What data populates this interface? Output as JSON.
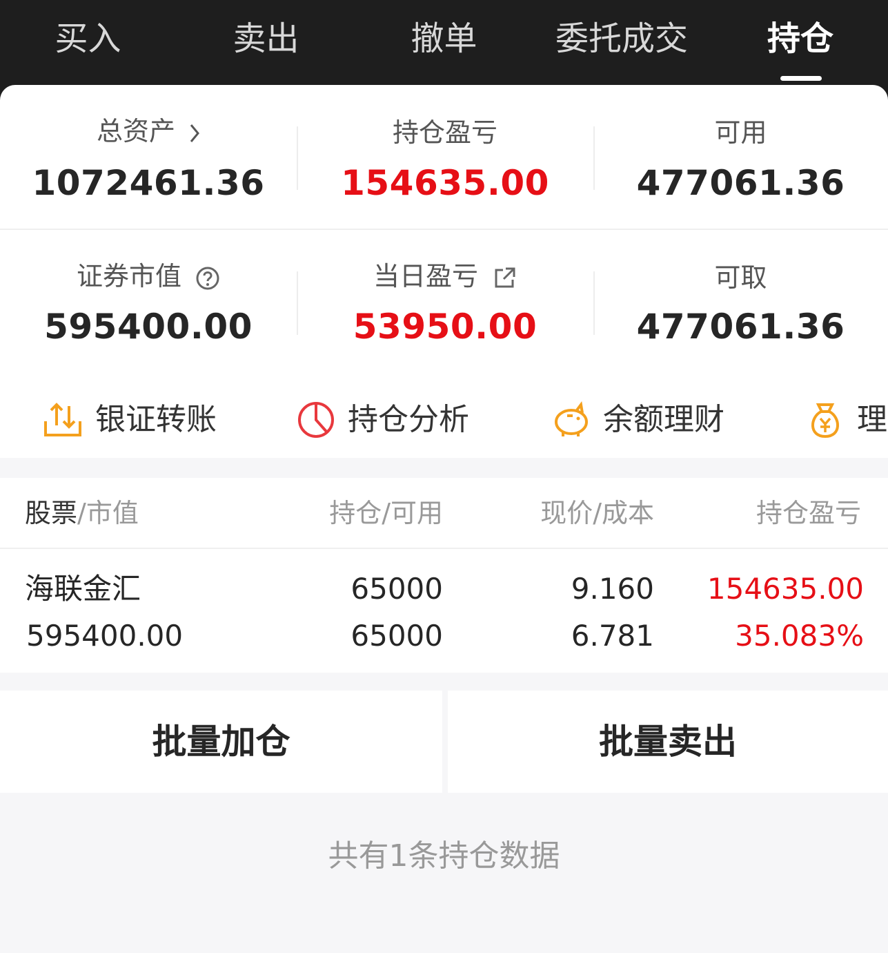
{
  "tabs": [
    {
      "label": "买入"
    },
    {
      "label": "卖出"
    },
    {
      "label": "撤单"
    },
    {
      "label": "委托成交"
    },
    {
      "label": "持仓",
      "active": true
    }
  ],
  "summary": {
    "total_assets_label": "总资产",
    "total_assets": "1072461.36",
    "position_pnl_label": "持仓盈亏",
    "position_pnl": "154635.00",
    "available_label": "可用",
    "available": "477061.36",
    "market_value_label": "证券市值",
    "market_value": "595400.00",
    "daily_pnl_label": "当日盈亏",
    "daily_pnl": "53950.00",
    "withdrawable_label": "可取",
    "withdrawable": "477061.36"
  },
  "quick_actions": [
    {
      "label": "银证转账",
      "icon": "transfer-icon"
    },
    {
      "label": "持仓分析",
      "icon": "pie-chart-icon"
    },
    {
      "label": "余额理财",
      "icon": "piggy-bank-icon"
    },
    {
      "label": "理财",
      "icon": "money-bag-icon"
    }
  ],
  "table": {
    "col1_main": "股票",
    "col1_sub": "/市值",
    "col2": "持仓/可用",
    "col3": "现价/成本",
    "col4": "持仓盈亏",
    "rows": [
      {
        "name": "海联金汇",
        "market_value": "595400.00",
        "position": "65000",
        "available": "65000",
        "price": "9.160",
        "cost": "6.781",
        "pnl": "154635.00",
        "pnl_pct": "35.083%"
      }
    ]
  },
  "buttons": {
    "batch_add": "批量加仓",
    "batch_sell": "批量卖出"
  },
  "footer_text": "共有1条持仓数据",
  "colors": {
    "red": "#e60f16",
    "orange": "#f4a01d",
    "topbar": "#1e1e1e"
  }
}
